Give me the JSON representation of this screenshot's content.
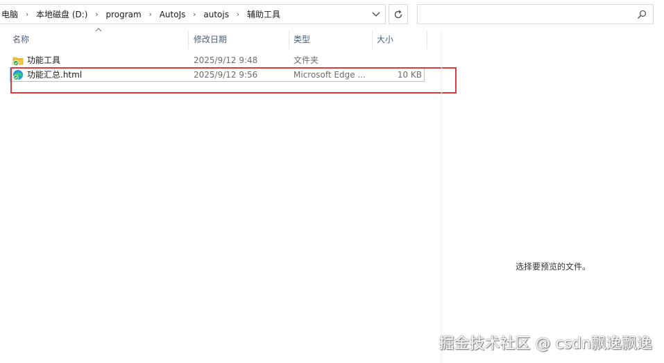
{
  "address_bar": {
    "crumbs": [
      "电脑",
      "本地磁盘 (D:)",
      "program",
      "AutoJs",
      "autojs",
      "辅助工具"
    ]
  },
  "search": {
    "placeholder": ""
  },
  "columns": {
    "name": "名称",
    "modified": "修改日期",
    "type": "类型",
    "size": "大小"
  },
  "files": [
    {
      "name": "功能工具",
      "modified": "2025/9/12 9:48",
      "type": "文件夹",
      "size": "",
      "icon": "folder-icon"
    },
    {
      "name": "功能汇总.html",
      "modified": "2025/9/12 9:56",
      "type": "Microsoft Edge ...",
      "size": "10 KB",
      "icon": "edge-html-icon"
    }
  ],
  "preview": {
    "message": "选择要预览的文件。"
  },
  "watermark": "掘金技术社区 @ csdn飘逸飘逸",
  "colors": {
    "highlight": "#e0383e",
    "selection_border": "#99c9ef",
    "header_text": "#4c607a"
  }
}
